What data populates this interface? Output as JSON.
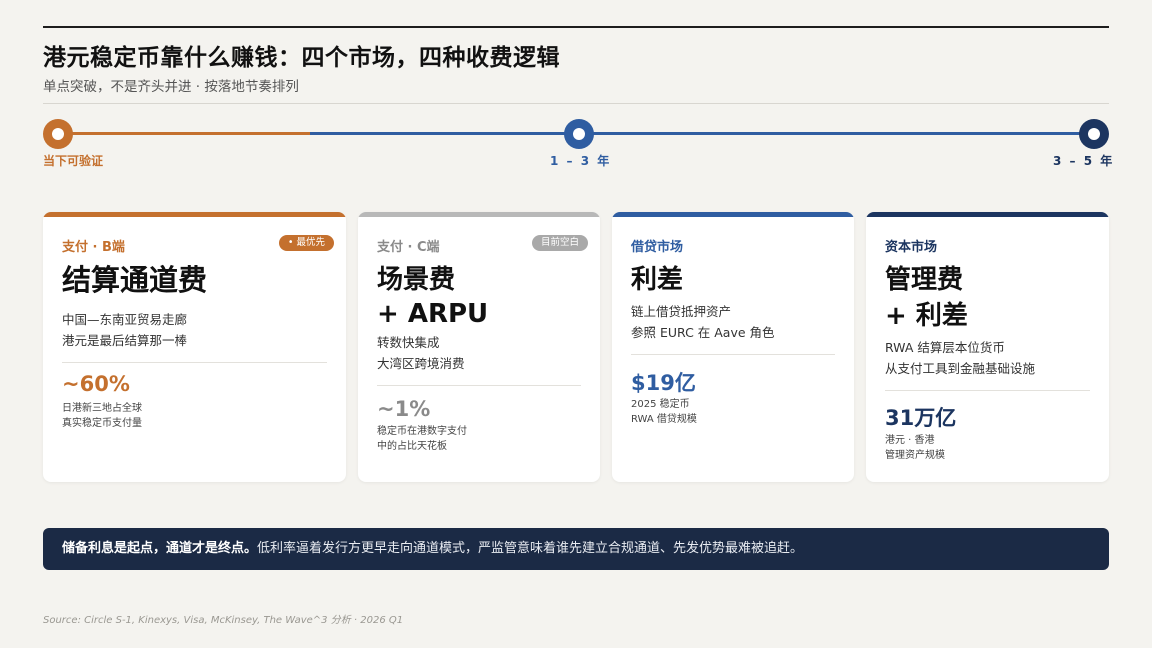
{
  "header": {
    "title": "港元稳定币靠什么赚钱：四个市场，四种收费逻辑",
    "subtitle": "单点突破，不是齐头并进 · 按落地节奏排列"
  },
  "timeline": {
    "now_label": "当下可验证",
    "mid_label": "1 – 3 年",
    "far_label": "3 – 5 年"
  },
  "cards": [
    {
      "category": "支付 · B端",
      "badge": "• 最优先",
      "headline": [
        "结算通道费"
      ],
      "description": [
        "中国—东南亚贸易走廊",
        "港元是最后结算那一棒"
      ],
      "stat": "~60%",
      "stat_desc": [
        "日港新三地占全球",
        "真实稳定币支付量"
      ]
    },
    {
      "category": "支付 · C端",
      "badge": "目前空白",
      "headline": [
        "场景费",
        "+ ARPU"
      ],
      "description": [
        "转数快集成",
        "大湾区跨境消费"
      ],
      "stat": "~1%",
      "stat_desc": [
        "稳定币在港数字支付",
        "中的占比天花板"
      ]
    },
    {
      "category": "借贷市场",
      "headline": [
        "利差"
      ],
      "description": [
        "链上借贷抵押资产",
        "参照 EURC 在 Aave 角色"
      ],
      "stat": "$19亿",
      "stat_desc": [
        "2025 稳定币",
        "RWA 借贷规模"
      ]
    },
    {
      "category": "资本市场",
      "headline": [
        "管理费",
        "+ 利差"
      ],
      "description": [
        "RWA 结算层本位货币",
        "从支付工具到金融基础设施"
      ],
      "stat": "31万亿",
      "stat_desc": [
        "港元 · 香港",
        "管理资产规模"
      ]
    }
  ],
  "callout": {
    "bold": "储备利息是起点，通道才是终点。",
    "text": "低利率逼着发行方更早走向通道模式，严监管意味着谁先建立合规通道、先发优势最难被追赶。"
  },
  "source": "Source: Circle S-1, Kinexys, Visa, McKinsey, The Wave^3 分析 · 2026 Q1",
  "colors": {
    "orange": "#c4702e",
    "gray": "#9a9a9a",
    "blue": "#2f5da1",
    "navy": "#1c3560",
    "callout_bg": "#1b2a45"
  }
}
